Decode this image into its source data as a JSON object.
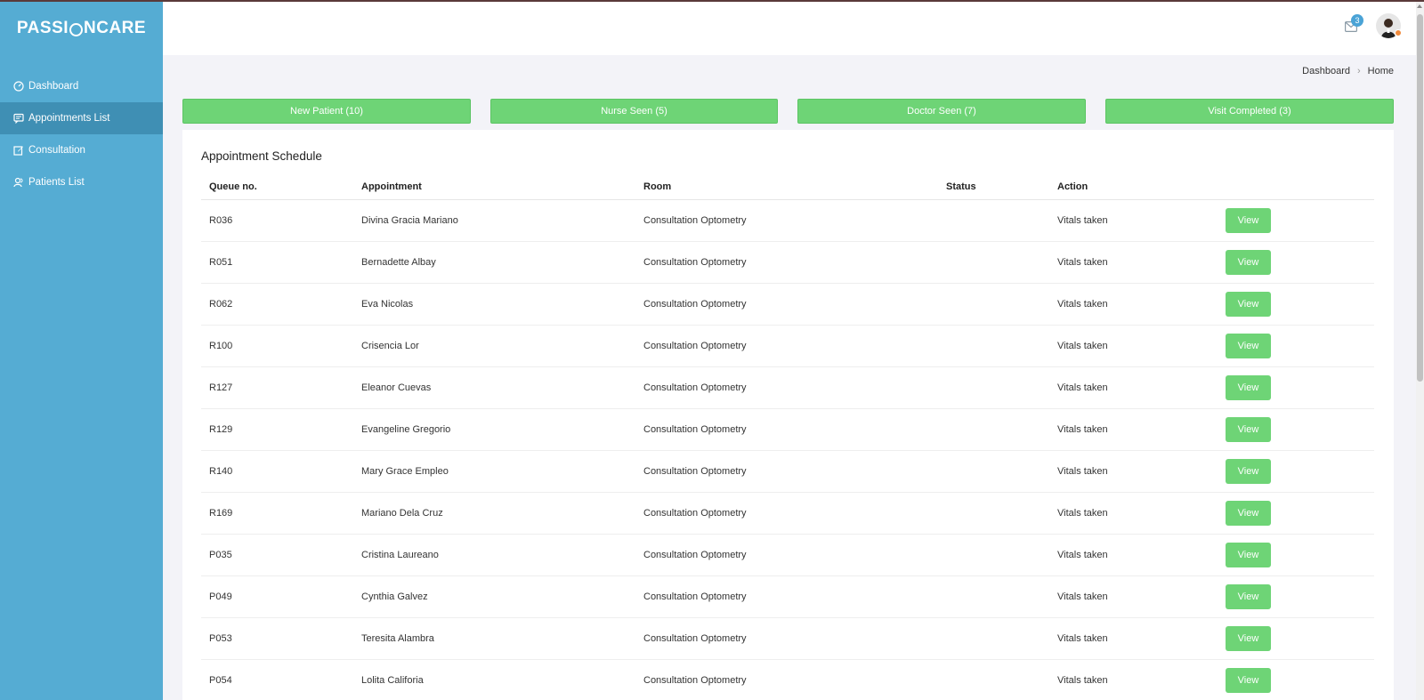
{
  "app": {
    "logo_left": "PASSI",
    "logo_right": "NCARE"
  },
  "sidebar": {
    "items": [
      {
        "label": "Dashboard",
        "icon": "gauge-icon"
      },
      {
        "label": "Appointments List",
        "icon": "chat-icon"
      },
      {
        "label": "Consultation",
        "icon": "edit-icon"
      },
      {
        "label": "Patients List",
        "icon": "users-icon"
      }
    ]
  },
  "header": {
    "mail_count": "3"
  },
  "breadcrumb": {
    "parent": "Dashboard",
    "current": "Home"
  },
  "status_buttons": [
    {
      "label": "New Patient (10)"
    },
    {
      "label": "Nurse Seen (5)"
    },
    {
      "label": "Doctor Seen (7)"
    },
    {
      "label": "Visit Completed (3)"
    }
  ],
  "schedule": {
    "title": "Appointment Schedule",
    "columns": [
      "Queue no.",
      "Appointment",
      "Room",
      "Status",
      "Action"
    ],
    "view_label": "View",
    "rows": [
      {
        "queue": "R036",
        "name": "Divina Gracia Mariano",
        "room": "Consultation Optometry",
        "status": "",
        "action": "Vitals taken"
      },
      {
        "queue": "R051",
        "name": "Bernadette Albay",
        "room": "Consultation Optometry",
        "status": "",
        "action": "Vitals taken"
      },
      {
        "queue": "R062",
        "name": "Eva Nicolas",
        "room": "Consultation Optometry",
        "status": "",
        "action": "Vitals taken"
      },
      {
        "queue": "R100",
        "name": "Crisencia Lor",
        "room": "Consultation Optometry",
        "status": "",
        "action": "Vitals taken"
      },
      {
        "queue": "R127",
        "name": "Eleanor Cuevas",
        "room": "Consultation Optometry",
        "status": "",
        "action": "Vitals taken"
      },
      {
        "queue": "R129",
        "name": "Evangeline Gregorio",
        "room": "Consultation Optometry",
        "status": "",
        "action": "Vitals taken"
      },
      {
        "queue": "R140",
        "name": "Mary Grace Empleo",
        "room": "Consultation Optometry",
        "status": "",
        "action": "Vitals taken"
      },
      {
        "queue": "R169",
        "name": "Mariano Dela Cruz",
        "room": "Consultation Optometry",
        "status": "",
        "action": "Vitals taken"
      },
      {
        "queue": "P035",
        "name": "Cristina Laureano",
        "room": "Consultation Optometry",
        "status": "",
        "action": "Vitals taken"
      },
      {
        "queue": "P049",
        "name": "Cynthia Galvez",
        "room": "Consultation Optometry",
        "status": "",
        "action": "Vitals taken"
      },
      {
        "queue": "P053",
        "name": "Teresita Alambra",
        "room": "Consultation Optometry",
        "status": "",
        "action": "Vitals taken"
      },
      {
        "queue": "P054",
        "name": "Lolita Califoria",
        "room": "Consultation Optometry",
        "status": "",
        "action": "Vitals taken"
      }
    ]
  },
  "colors": {
    "sidebar": "#55acd3",
    "sidebar_active": "#3f8fb4",
    "accent_green": "#6ed476",
    "badge_blue": "#4aa3d6"
  }
}
